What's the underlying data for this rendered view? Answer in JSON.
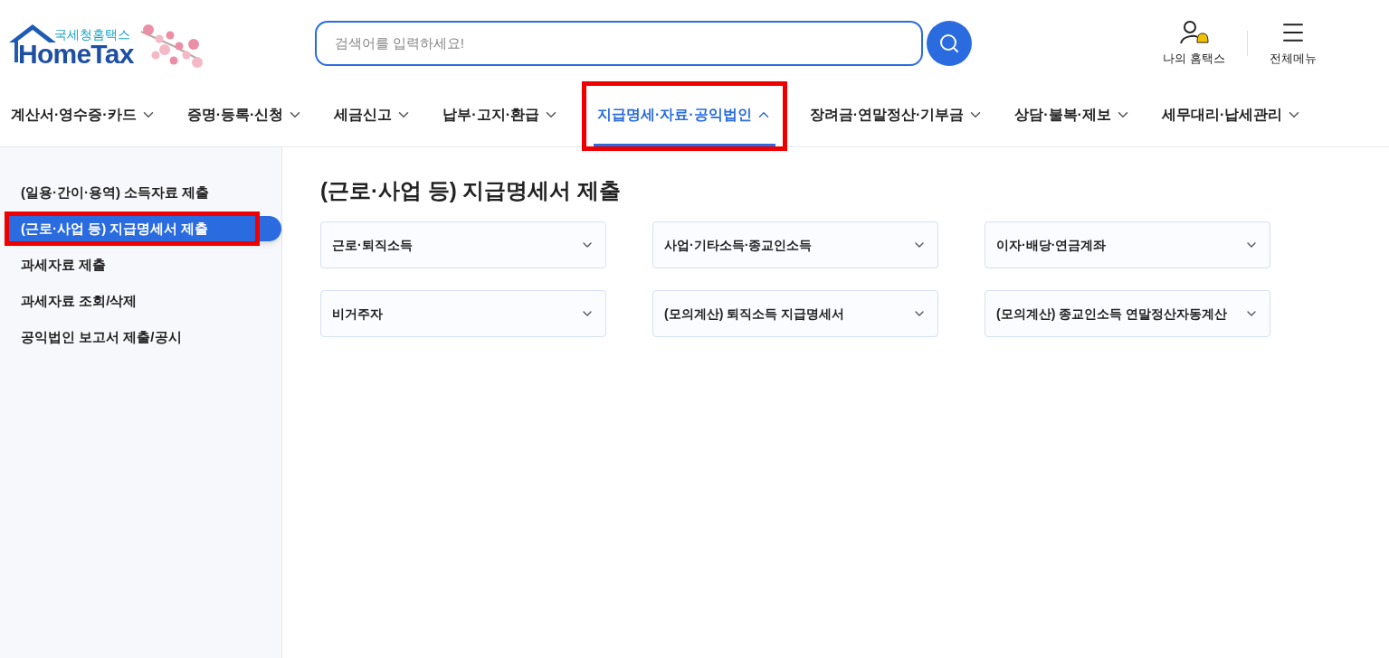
{
  "logo": {
    "subtitle": "국세청홈택스",
    "title": "HomeTax"
  },
  "search": {
    "placeholder": "검색어를 입력하세요!"
  },
  "header_links": [
    {
      "kind": "user",
      "label": "나의 홈택스"
    },
    {
      "kind": "menu",
      "label": "전체메뉴"
    }
  ],
  "nav": [
    {
      "label": "계산서·영수증·카드",
      "selected": false,
      "highlighted": false
    },
    {
      "label": "증명·등록·신청",
      "selected": false,
      "highlighted": false
    },
    {
      "label": "세금신고",
      "selected": false,
      "highlighted": false
    },
    {
      "label": "납부·고지·환급",
      "selected": false,
      "highlighted": false
    },
    {
      "label": "지급명세·자료·공익법인",
      "selected": true,
      "highlighted": true
    },
    {
      "label": "장려금·연말정산·기부금",
      "selected": false,
      "highlighted": false
    },
    {
      "label": "상담·불복·제보",
      "selected": false,
      "highlighted": false
    },
    {
      "label": "세무대리·납세관리",
      "selected": false,
      "highlighted": false
    }
  ],
  "sidebar": {
    "items": [
      {
        "label": "(일용·간이·용역) 소득자료 제출",
        "selected": false,
        "highlighted": false
      },
      {
        "label": "(근로·사업 등) 지급명세서 제출",
        "selected": true,
        "highlighted": true
      },
      {
        "label": "과세자료 제출",
        "selected": false,
        "highlighted": false
      },
      {
        "label": "과세자료 조회/삭제",
        "selected": false,
        "highlighted": false
      },
      {
        "label": "공익법인 보고서 제출/공시",
        "selected": false,
        "highlighted": false
      }
    ]
  },
  "page_title": "(근로·사업 등) 지급명세서 제출",
  "sections": [
    {
      "label": "근로·퇴직소득",
      "expanded": false
    },
    {
      "label": "사업·기타소득·종교인소득",
      "expanded": false
    },
    {
      "label": "이자·배당·연금계좌",
      "expanded": false
    },
    {
      "label": "비거주자",
      "expanded": false
    },
    {
      "label": "(모의계산) 퇴직소득 지급명세서",
      "expanded": false
    },
    {
      "label": "(모의계산) 종교인소득 연말정산자동계산",
      "expanded": false
    }
  ]
}
